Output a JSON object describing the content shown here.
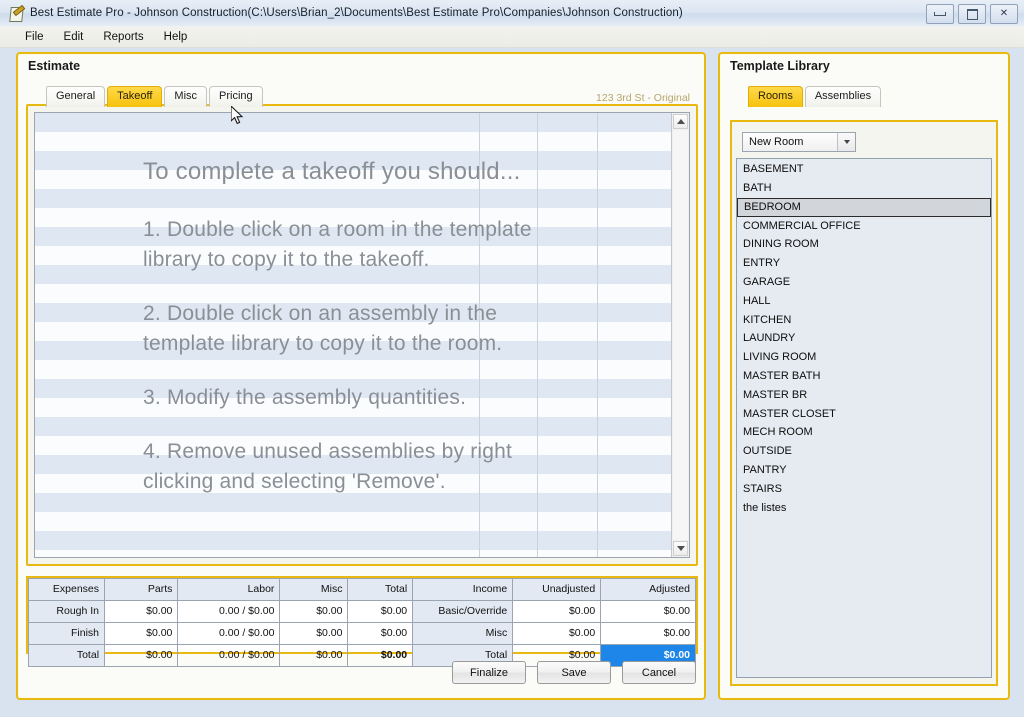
{
  "window": {
    "title": "Best Estimate Pro - Johnson Construction(C:\\Users\\Brian_2\\Documents\\Best Estimate Pro\\Companies\\Johnson Construction)",
    "icon": "document-pen-icon",
    "controls": {
      "minimize": "minimize-icon",
      "maximize": "maximize-icon",
      "close": "✕"
    }
  },
  "menubar": {
    "items": [
      {
        "label": "File"
      },
      {
        "label": "Edit"
      },
      {
        "label": "Reports"
      },
      {
        "label": "Help"
      }
    ]
  },
  "estimate": {
    "title": "Estimate",
    "tabs": [
      {
        "label": "General",
        "selected": false
      },
      {
        "label": "Takeoff",
        "selected": true
      },
      {
        "label": "Misc",
        "selected": false
      },
      {
        "label": "Pricing",
        "selected": false
      }
    ],
    "context_label": "123 3rd St - Original",
    "takeoff": {
      "heading": "To complete a takeoff you should...",
      "steps": [
        "1. Double click on a room in the template library to copy it to the takeoff.",
        "2. Double click on an assembly in the template library to copy it to the room.",
        "3. Modify the assembly quantities.",
        "4. Remove unused assemblies by right clicking and selecting 'Remove'."
      ]
    },
    "totals": {
      "headers": [
        "Expenses",
        "Parts",
        "Labor",
        "Misc",
        "Total",
        "Income",
        "Unadjusted",
        "Adjusted"
      ],
      "rows": [
        {
          "expense_label": "Rough In",
          "parts": "$0.00",
          "labor": "0.00 / $0.00",
          "misc": "$0.00",
          "total": "$0.00",
          "income_label": "Basic/Override",
          "unadjusted": "$0.00",
          "adjusted": "$0.00"
        },
        {
          "expense_label": "Finish",
          "parts": "$0.00",
          "labor": "0.00 / $0.00",
          "misc": "$0.00",
          "total": "$0.00",
          "income_label": "Misc",
          "unadjusted": "$0.00",
          "adjusted": "$0.00"
        },
        {
          "expense_label": "Total",
          "parts": "$0.00",
          "labor": "0.00 / $0.00",
          "misc": "$0.00",
          "total": "$0.00",
          "income_label": "Total",
          "unadjusted": "$0.00",
          "adjusted": "$0.00"
        }
      ],
      "selected_cell": "adjusted-total"
    },
    "buttons": [
      {
        "label": "Finalize"
      },
      {
        "label": "Save"
      },
      {
        "label": "Cancel"
      }
    ]
  },
  "library": {
    "title": "Template Library",
    "tabs": [
      {
        "label": "Rooms",
        "selected": true
      },
      {
        "label": "Assemblies",
        "selected": false
      }
    ],
    "dropdown": {
      "value": "New Room",
      "icon": "chevron-down-icon"
    },
    "rooms": [
      {
        "label": "BASEMENT",
        "selected": false
      },
      {
        "label": "BATH",
        "selected": false
      },
      {
        "label": "BEDROOM",
        "selected": true
      },
      {
        "label": "COMMERCIAL OFFICE",
        "selected": false
      },
      {
        "label": "DINING ROOM",
        "selected": false
      },
      {
        "label": "ENTRY",
        "selected": false
      },
      {
        "label": "GARAGE",
        "selected": false
      },
      {
        "label": "HALL",
        "selected": false
      },
      {
        "label": "KITCHEN",
        "selected": false
      },
      {
        "label": "LAUNDRY",
        "selected": false
      },
      {
        "label": "LIVING ROOM",
        "selected": false
      },
      {
        "label": "MASTER BATH",
        "selected": false
      },
      {
        "label": "MASTER BR",
        "selected": false
      },
      {
        "label": "MASTER CLOSET",
        "selected": false
      },
      {
        "label": "MECH ROOM",
        "selected": false
      },
      {
        "label": "OUTSIDE",
        "selected": false
      },
      {
        "label": "PANTRY",
        "selected": false
      },
      {
        "label": "STAIRS",
        "selected": false
      },
      {
        "label": "the listes",
        "selected": false
      }
    ]
  },
  "colors": {
    "accent_gold": "#e8b910",
    "tab_selected": "#f6c20c",
    "cell_selected": "#1e86e8",
    "stripe": "#dfe7f2"
  }
}
